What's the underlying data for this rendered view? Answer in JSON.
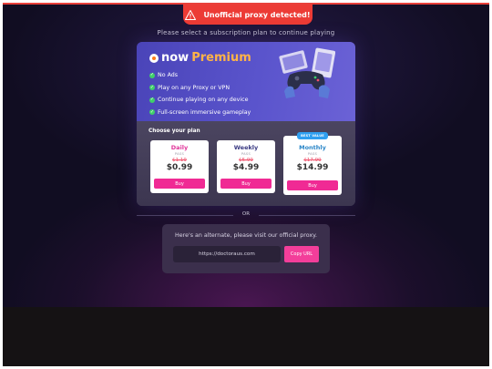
{
  "alert": {
    "icon": "warning-icon",
    "text": "Unofficial proxy detected!"
  },
  "subtitle": "Please select a subscription plan to continue playing",
  "premium": {
    "brand": "now",
    "product": "Premium",
    "features": [
      "No Ads",
      "Play on any Proxy or VPN",
      "Continue playing on any device",
      "Full-screen immersive gameplay"
    ]
  },
  "plans": {
    "heading": "Choose your plan",
    "items": [
      {
        "name": "Daily",
        "pass": "PASS",
        "old_price": "$1.19",
        "price": "$0.99",
        "buy": "Buy",
        "name_color": "#e0359a"
      },
      {
        "name": "Weekly",
        "pass": "PASS",
        "old_price": "$5.99",
        "price": "$4.99",
        "buy": "Buy",
        "name_color": "#3a3a82"
      },
      {
        "name": "Monthly",
        "pass": "PASS",
        "old_price": "$17.99",
        "price": "$14.99",
        "buy": "Buy",
        "name_color": "#2a86c8",
        "badge": "BEST VALUE"
      }
    ]
  },
  "separator": "OR",
  "alternate": {
    "text": "Here's an alternate, please visit our official proxy.",
    "url": "https://doctoraus.com",
    "copy_label": "Copy URL"
  },
  "colors": {
    "accent": "#f02a94",
    "alert": "#ec3b35",
    "premium_bg": "#5a54cc",
    "badge": "#2f9ff0"
  }
}
